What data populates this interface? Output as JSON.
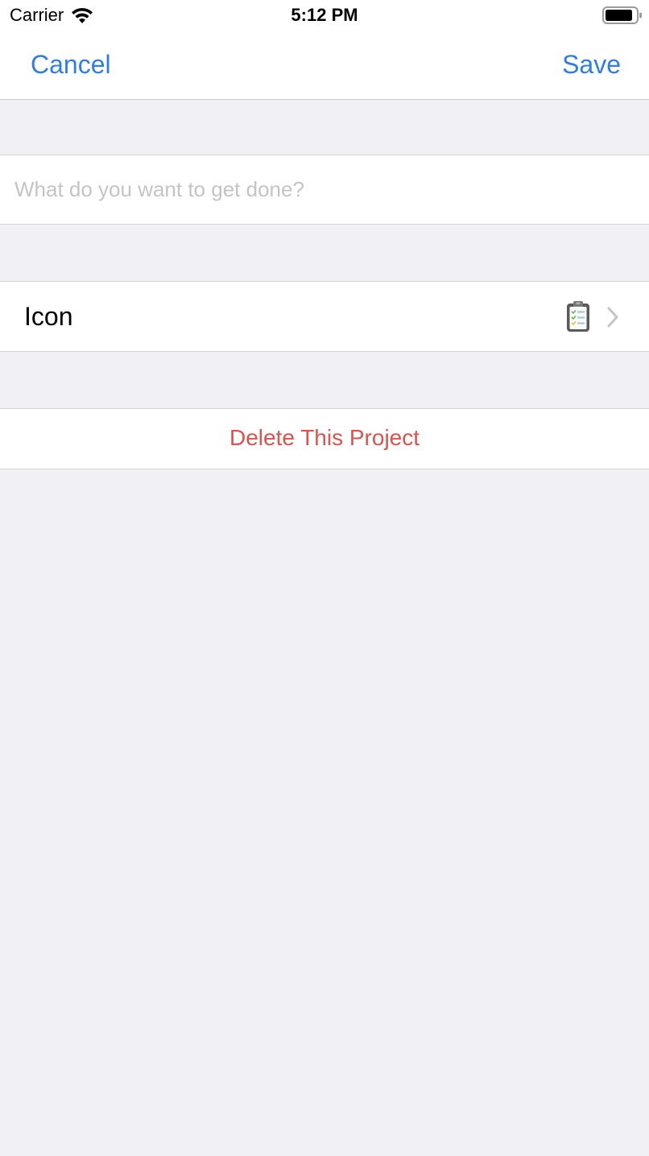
{
  "status_bar": {
    "carrier": "Carrier",
    "time": "5:12 PM",
    "icons": [
      "wifi-icon",
      "battery-icon"
    ]
  },
  "nav": {
    "cancel_label": "Cancel",
    "save_label": "Save",
    "accent_color": "#2f7ee6"
  },
  "title_field": {
    "value": "",
    "placeholder": "What do you want to get done?"
  },
  "icon_row": {
    "label": "Icon",
    "selected_icon": "clipboard-checklist-icon",
    "accessory": "chevron-right-icon"
  },
  "delete_row": {
    "label": "Delete This Project",
    "color": "#d9534f"
  },
  "colors": {
    "background": "#f0f0f5",
    "cell_background": "#ffffff"
  }
}
